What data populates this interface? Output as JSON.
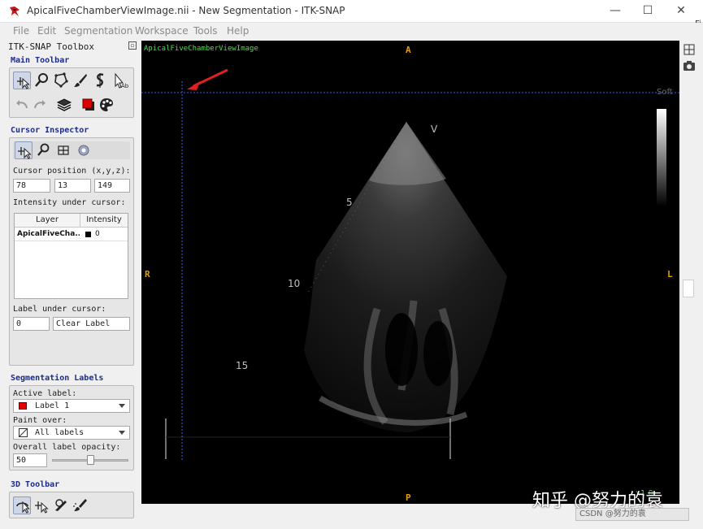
{
  "window": {
    "title": "ApicalFiveChamberViewImage.nii - New Segmentation - ITK-SNAP",
    "minimize": "—",
    "maximize": "☐",
    "close": "✕"
  },
  "menu": [
    "File",
    "Edit",
    "Segmentation",
    "Workspace",
    "Tools",
    "Help"
  ],
  "toolbox": {
    "title": "ITK-SNAP Toolbox",
    "main_toolbar_title": "Main Toolbar",
    "cursor_inspector_title": "Cursor Inspector",
    "cursor_position_label": "Cursor position (x,y,z):",
    "cursor_x": "78",
    "cursor_y": "13",
    "cursor_z": "149",
    "intensity_label": "Intensity under cursor:",
    "layer_header": "Layer",
    "intensity_header": "Intensity",
    "layer_name": "ApicalFiveCha...",
    "layer_intensity": "0",
    "label_under_cursor_label": "Label under cursor:",
    "label_value": "0",
    "label_name": "Clear Label",
    "segmentation_labels_title": "Segmentation Labels",
    "active_label_label": "Active label:",
    "active_label_value": "Label 1",
    "active_label_color": "#e00000",
    "paint_over_label": "Paint over:",
    "paint_over_value": "All labels",
    "opacity_label": "Overall label opacity:",
    "opacity_value": "50",
    "opacity_fraction": 0.5,
    "toolbar_3d_title": "3D Toolbar"
  },
  "viewer": {
    "image_name": "ApicalFiveChamberViewImage",
    "orient_top": "A",
    "orient_bottom": "P",
    "orient_left": "R",
    "orient_right": "L",
    "soft_label": "Soft",
    "depth_5": "5",
    "depth_10": "10",
    "depth_15": "15",
    "view_mark": "V",
    "crosshair_color": "#3c5cff",
    "zoom_text": "x1.0"
  },
  "status_text": "CSDN @努力的袁",
  "watermark": "知乎 @努力的袁",
  "fi_edge": "Fi"
}
